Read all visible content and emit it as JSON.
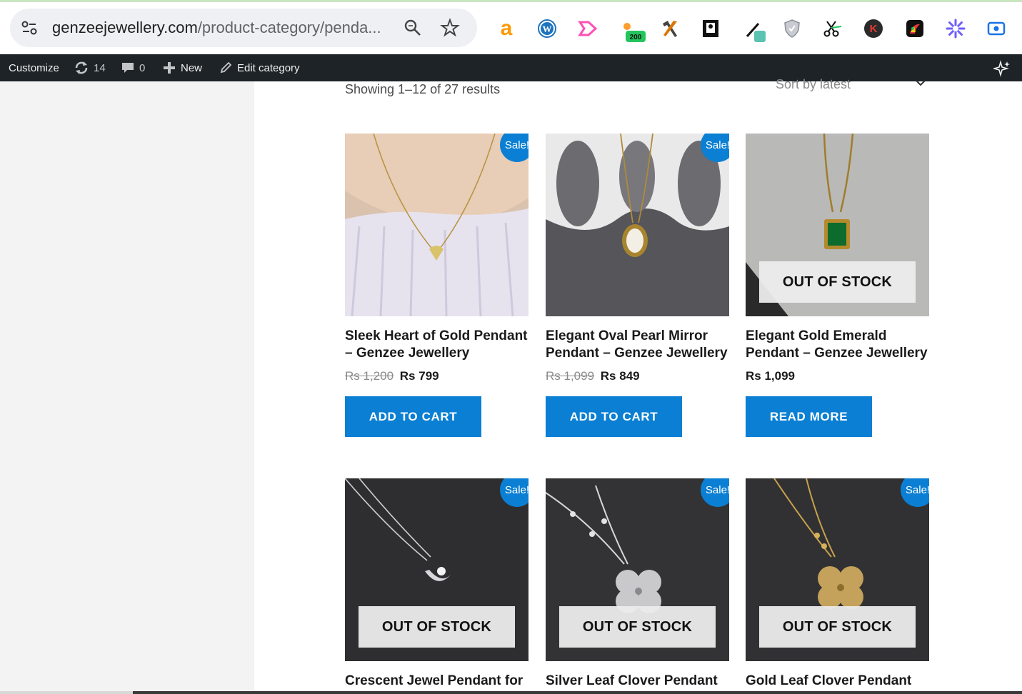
{
  "browser": {
    "url_host": "genzeejewellery.com",
    "url_path": "/product-category/penda...",
    "extensions": [
      "amazon-assistant-icon",
      "wordpress-icon",
      "pink-arrow-icon",
      "counter-badge-icon",
      "tools-hammer-icon",
      "notebook-icon",
      "eyedropper-icon",
      "shield-icon",
      "scissors-icon",
      "k-circle-icon",
      "photo-editor-icon",
      "gear-flower-icon",
      "screen-record-icon"
    ],
    "badge_count": "200"
  },
  "adminbar": {
    "customize": "Customize",
    "updates_count": "14",
    "comments_count": "0",
    "new_label": "New",
    "edit_label": "Edit category"
  },
  "shop": {
    "results_text": "Showing 1–12 of 27 results",
    "sort_label": "Sort by latest",
    "products": [
      {
        "title": "Sleek Heart of Gold Pendant – Genzee Jewellery",
        "old_price": "Rs 1,200",
        "price": "Rs 799",
        "sale": "Sale!",
        "out_of_stock": "",
        "button": "ADD TO CART"
      },
      {
        "title": "Elegant Oval Pearl Mirror Pendant – Genzee Jewellery",
        "old_price": "Rs 1,099",
        "price": "Rs 849",
        "sale": "Sale!",
        "out_of_stock": "",
        "button": "ADD TO CART"
      },
      {
        "title": "Elegant Gold Emerald Pendant – Genzee Jewellery",
        "old_price": "",
        "price": "Rs 1,099",
        "sale": "",
        "out_of_stock": "OUT OF STOCK",
        "button": "READ MORE"
      },
      {
        "title": "Crescent Jewel Pendant for a",
        "sale": "Sale!",
        "out_of_stock": "OUT OF STOCK"
      },
      {
        "title": "Silver Leaf Clover Pendant for",
        "sale": "Sale!",
        "out_of_stock": "OUT OF STOCK"
      },
      {
        "title": "Gold Leaf Clover Pendant for",
        "sale": "Sale!",
        "out_of_stock": "OUT OF STOCK"
      }
    ]
  },
  "colors": {
    "accent": "#0a7fd3",
    "adminbar": "#1d2327"
  }
}
